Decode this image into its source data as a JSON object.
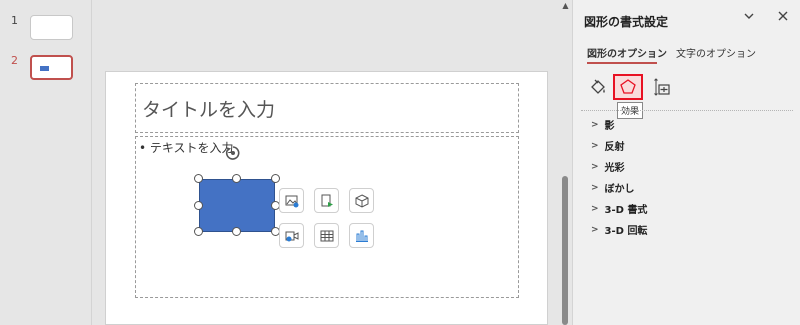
{
  "thumbnails": [
    {
      "number": "1"
    },
    {
      "number": "2"
    }
  ],
  "slide": {
    "title_placeholder": "タイトルを入力",
    "body_placeholder": "• テキストを入力"
  },
  "format_pane": {
    "title": "図形の書式設定",
    "tabs": [
      {
        "label": "図形のオプション",
        "active": true
      },
      {
        "label": "文字のオプション",
        "active": false
      }
    ],
    "icons": [
      "fill-line-icon",
      "effects-icon",
      "size-properties-icon"
    ],
    "tooltip": "効果",
    "sections": [
      {
        "label": "影"
      },
      {
        "label": "反射"
      },
      {
        "label": "光彩"
      },
      {
        "label": "ぼかし"
      },
      {
        "label": "3-D 書式"
      },
      {
        "label": "3-D 回転"
      }
    ]
  },
  "colors": {
    "accent": "#c0504d",
    "shape_fill": "#4472c4",
    "highlight": "#e81123"
  }
}
